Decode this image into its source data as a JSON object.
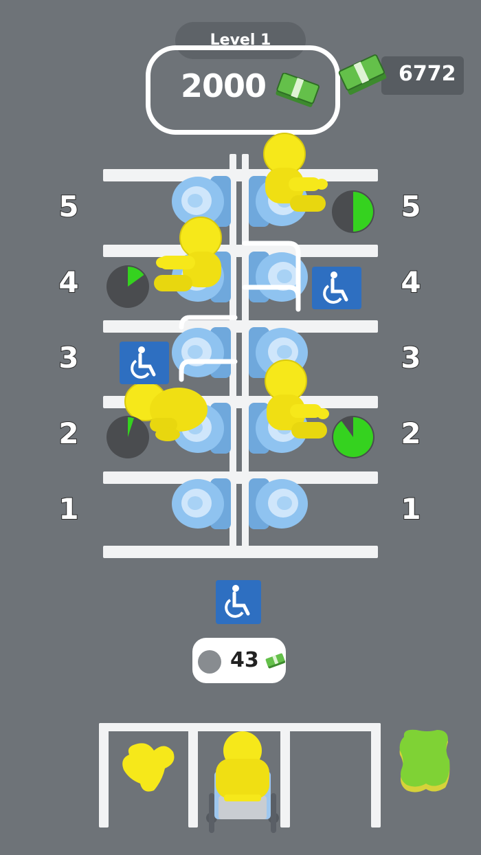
{
  "hud": {
    "level_label": "Level 1",
    "target_money": "2000",
    "cash_balance": "6772",
    "money_icon": "cash-stack-icon"
  },
  "stalls": {
    "left_numbers": [
      "5",
      "4",
      "3",
      "2",
      "1"
    ],
    "right_numbers": [
      "5",
      "4",
      "3",
      "2",
      "1"
    ],
    "toilet_color": "#8fc3f0",
    "person_color": "#f6e81a",
    "timers": [
      {
        "side": "right",
        "row": "5",
        "progress": 0.5
      },
      {
        "side": "left",
        "row": "4",
        "progress": 0.15
      },
      {
        "side": "left",
        "row": "2",
        "progress": 0.05
      },
      {
        "side": "right",
        "row": "2",
        "progress": 0.9
      }
    ],
    "accessible_markers": [
      {
        "side": "right",
        "row": "4"
      },
      {
        "side": "left",
        "row": "3"
      }
    ]
  },
  "unlock": {
    "icon": "wheelchair-icon",
    "cost": "43",
    "coin_icon": "coin-icon",
    "money_icon": "cash-stack-icon"
  },
  "queue": {
    "slots": 3,
    "spill_color": "#f6e81a",
    "sponge_color": "#7fd235"
  }
}
